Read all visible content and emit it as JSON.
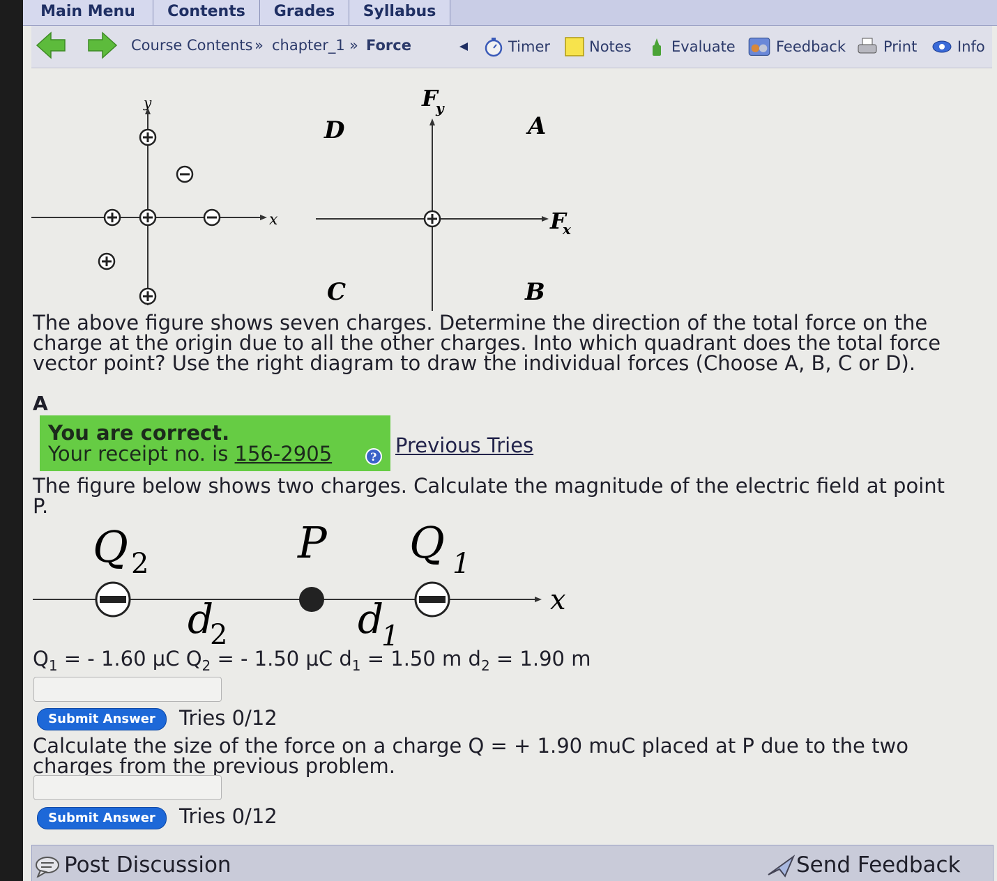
{
  "menu": {
    "tabs": [
      "Main Menu",
      "Contents",
      "Grades",
      "Syllabus"
    ]
  },
  "nav": {
    "breadcrumb": {
      "course": "Course Contents",
      "sep1": "»",
      "chapter": "chapter_1",
      "sep2": "»",
      "page": "Force"
    },
    "tools": [
      {
        "label": "Timer",
        "icon": "timer-icon"
      },
      {
        "label": "Notes",
        "icon": "notes-icon"
      },
      {
        "label": "Evaluate",
        "icon": "evaluate-icon"
      },
      {
        "label": "Feedback",
        "icon": "feedback-icon"
      },
      {
        "label": "Print",
        "icon": "print-icon"
      },
      {
        "label": "Info",
        "icon": "info-icon"
      }
    ],
    "colors": {
      "arrow_green": "#5dbb3c",
      "menu_text": "#1f2f63"
    }
  },
  "figure1": {
    "left": {
      "y_label": "y",
      "x_label": "x"
    },
    "right": {
      "fy": "F",
      "fy_sub": "y",
      "fx": "F",
      "fx_sub": "x",
      "quadrants": {
        "A": "A",
        "B": "B",
        "C": "C",
        "D": "D"
      }
    }
  },
  "problem1": {
    "text": "The above figure shows seven charges. Determine the direction of the total force on the charge at the origin due to all the other charges. Into which quadrant does the total force vector point? Use the right diagram to draw the individual forces (Choose A, B, C or D).",
    "answer": "A",
    "feedback": {
      "line1": "You are correct.",
      "line2_prefix": "Your receipt no. is",
      "receipt": "156-2905",
      "color": "#66cc44"
    },
    "previous_tries": "Previous Tries"
  },
  "problem2": {
    "text": "The figure below shows two charges. Calculate the magnitude of the electric field at point P.",
    "figure": {
      "q2": "Q",
      "q2_sub": "2",
      "p": "P",
      "q1": "Q",
      "q1_sub": "1",
      "d2": "d",
      "d2_sub": "2",
      "d1": "d",
      "d1_sub": "1",
      "x": "x"
    },
    "values": {
      "q1_name": "Q",
      "q1_sub": "1",
      "q1_val": " = - 1.60 μC ",
      "q2_name": "Q",
      "q2_sub": "2",
      "q2_val": " = - 1.50 μC ",
      "d1_name": "d",
      "d1_sub": "1",
      "d1_val": " = 1.50 m ",
      "d2_name": "d",
      "d2_sub": "2",
      "d2_val": " = 1.90 m"
    },
    "input_value": "",
    "submit_label": "Submit Answer",
    "tries": "Tries 0/12"
  },
  "problem3": {
    "text_line1": "Calculate the size of the force on a charge Q = + 1.90 muC placed at P due to the two",
    "text_line2": "charges from the previous problem.",
    "input_value": "",
    "submit_label": "Submit Answer",
    "tries": "Tries 0/12"
  },
  "footer": {
    "post_discussion": "Post Discussion",
    "send_feedback": "Send Feedback"
  }
}
